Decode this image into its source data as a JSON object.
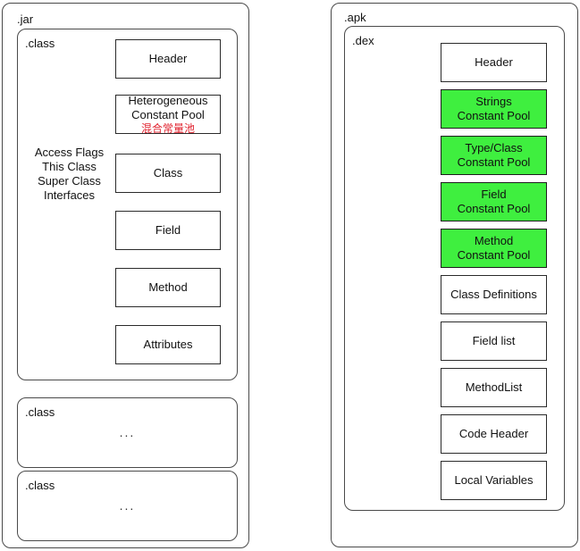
{
  "jar": {
    "label": ".jar",
    "class_main": {
      "label": ".class",
      "side_note": {
        "line1": "Access Flags",
        "line2": "This Class",
        "line3": "Super Class",
        "line4": "Interfaces"
      },
      "boxes": [
        {
          "line1": "Header",
          "line2": "",
          "cn": "",
          "green": false
        },
        {
          "line1": "Heterogeneous",
          "line2": "Constant Pool",
          "cn": "混合常量池",
          "green": false
        },
        {
          "line1": "Class",
          "line2": "",
          "cn": "",
          "green": false
        },
        {
          "line1": "Field",
          "line2": "",
          "cn": "",
          "green": false
        },
        {
          "line1": "Method",
          "line2": "",
          "cn": "",
          "green": false
        },
        {
          "line1": "Attributes",
          "line2": "",
          "cn": "",
          "green": false
        }
      ]
    },
    "class_placeholder_2": {
      "label": ".class",
      "ellipsis": "..."
    },
    "class_placeholder_3": {
      "label": ".class",
      "ellipsis": "..."
    }
  },
  "apk": {
    "label": ".apk",
    "dex": {
      "label": ".dex",
      "boxes": [
        {
          "line1": "Header",
          "line2": "",
          "green": false
        },
        {
          "line1": "Strings",
          "line2": "Constant Pool",
          "green": true
        },
        {
          "line1": "Type/Class",
          "line2": "Constant Pool",
          "green": true
        },
        {
          "line1": "Field",
          "line2": "Constant Pool",
          "green": true
        },
        {
          "line1": "Method",
          "line2": "Constant Pool",
          "green": true
        },
        {
          "line1": "Class Definitions",
          "line2": "",
          "green": false
        },
        {
          "line1": "Field list",
          "line2": "",
          "green": false
        },
        {
          "line1": "MethodList",
          "line2": "",
          "green": false
        },
        {
          "line1": "Code Header",
          "line2": "",
          "green": false
        },
        {
          "line1": "Local Variables",
          "line2": "",
          "green": false
        }
      ]
    }
  },
  "colors": {
    "highlight_green": "#3FEF3F",
    "chinese_text_red": "#E0202C",
    "border": "#2B2B2B"
  }
}
